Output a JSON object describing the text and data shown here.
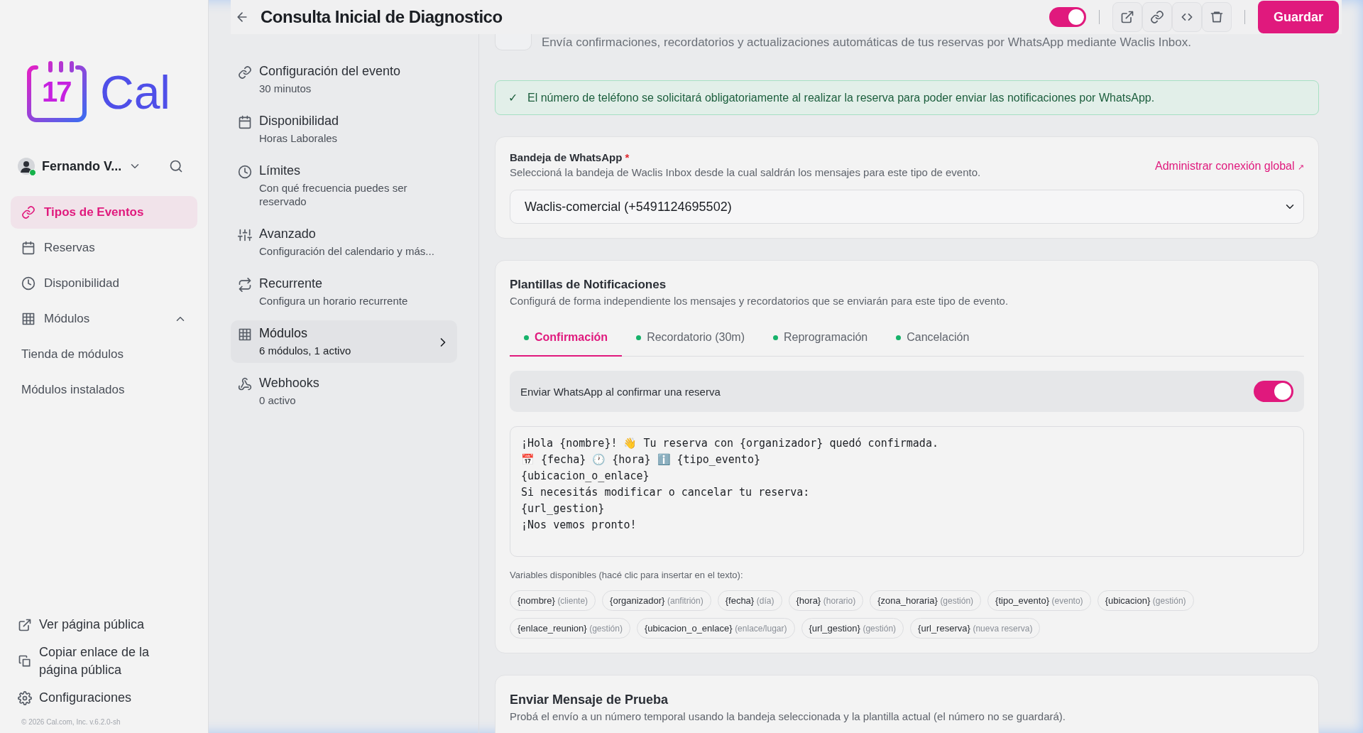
{
  "logo": {
    "number": "17",
    "text": "Cal"
  },
  "user": {
    "name": "Fernando V...",
    "online": true
  },
  "sidebar": {
    "items": [
      {
        "label": "Tipos de Eventos",
        "selected": true
      },
      {
        "label": "Reservas",
        "selected": false
      },
      {
        "label": "Disponibilidad",
        "selected": false
      },
      {
        "label": "Módulos",
        "selected": false,
        "expanded": true,
        "children": [
          {
            "label": "Tienda de módulos",
            "selected": false
          },
          {
            "label": "Módulos instalados",
            "selected": false
          }
        ]
      }
    ],
    "footer_items": [
      {
        "label": "Ver página pública"
      },
      {
        "label": "Copiar enlace de la página pública"
      },
      {
        "label": "Configuraciones"
      }
    ],
    "copyright": "© 2026 Cal.com, Inc. v.6.2.0-sh"
  },
  "header": {
    "title": "Consulta Inicial de Diagnostico",
    "published": true,
    "save": "Guardar"
  },
  "event_nav": [
    {
      "title": "Configuración del evento",
      "subtitle": "30 minutos",
      "selected": false
    },
    {
      "title": "Disponibilidad",
      "subtitle": "Horas Laborales",
      "selected": false
    },
    {
      "title": "Límites",
      "subtitle": "Con qué frecuencia puedes ser reservado",
      "selected": false
    },
    {
      "title": "Avanzado",
      "subtitle": "Configuración del calendario y más...",
      "selected": false
    },
    {
      "title": "Recurrente",
      "subtitle": "Configura un horario recurrente",
      "selected": false
    },
    {
      "title": "Módulos",
      "subtitle": "6 módulos, 1 activo",
      "selected": true
    },
    {
      "title": "Webhooks",
      "subtitle": "0 activo",
      "selected": false
    }
  ],
  "intro": "Envía confirmaciones, recordatorios y actualizaciones automáticas de tus reservas por WhatsApp mediante Waclis Inbox.",
  "alert": {
    "icon": "✓",
    "text": "El número de teléfono se solicitará obligatoriamente al realizar la reserva para poder enviar las notificaciones por WhatsApp."
  },
  "inbox_card": {
    "label": "Bandeja de WhatsApp",
    "required": "*",
    "description": "Seleccioná la bandeja de Waclis Inbox desde la cual saldrán los mensajes para este tipo de evento.",
    "link": "Administrar conexión global",
    "link_icon": "↗",
    "value": "Waclis-comercial (+5491124695502)"
  },
  "templates_card": {
    "title": "Plantillas de Notificaciones",
    "description": "Configurá de forma independiente los mensajes y recordatorios que se enviarán para este tipo de evento.",
    "tabs": [
      {
        "label": "Confirmación",
        "selected": true,
        "enabled": true
      },
      {
        "label": "Recordatorio (30m)",
        "selected": false,
        "enabled": true
      },
      {
        "label": "Reprogramación",
        "selected": false,
        "enabled": true
      },
      {
        "label": "Cancelación",
        "selected": false,
        "enabled": true
      }
    ],
    "send_toggle": {
      "label": "Enviar WhatsApp al confirmar una reserva",
      "on": true
    },
    "message": "¡Hola {nombre}! 👋 Tu reserva con {organizador} quedó confirmada.\n📅 {fecha} 🕐 {hora} ℹ️ {tipo_evento}\n{ubicacion_o_enlace}\nSi necesitás modificar o cancelar tu reserva:\n{url_gestion}\n¡Nos vemos pronto!",
    "variables_label": "Variables disponibles (hacé clic para insertar en el texto):",
    "variables": [
      {
        "name": "{nombre}",
        "hint": "(cliente)"
      },
      {
        "name": "{organizador}",
        "hint": "(anfitrión)"
      },
      {
        "name": "{fecha}",
        "hint": "(día)"
      },
      {
        "name": "{hora}",
        "hint": "(horario)"
      },
      {
        "name": "{zona_horaria}",
        "hint": "(gestión)"
      },
      {
        "name": "{tipo_evento}",
        "hint": "(evento)"
      },
      {
        "name": "{ubicacion}",
        "hint": "(gestión)"
      },
      {
        "name": "{enlace_reunion}",
        "hint": "(gestión)"
      },
      {
        "name": "{ubicacion_o_enlace}",
        "hint": "(enlace/lugar)"
      },
      {
        "name": "{url_gestion}",
        "hint": "(gestión)"
      },
      {
        "name": "{url_reserva}",
        "hint": "(nueva reserva)"
      }
    ]
  },
  "test_card": {
    "title": "Enviar Mensaje de Prueba",
    "description": "Probá el envío a un número temporal usando la bandeja seleccionada y la plantilla actual (el número no se guardará)."
  }
}
